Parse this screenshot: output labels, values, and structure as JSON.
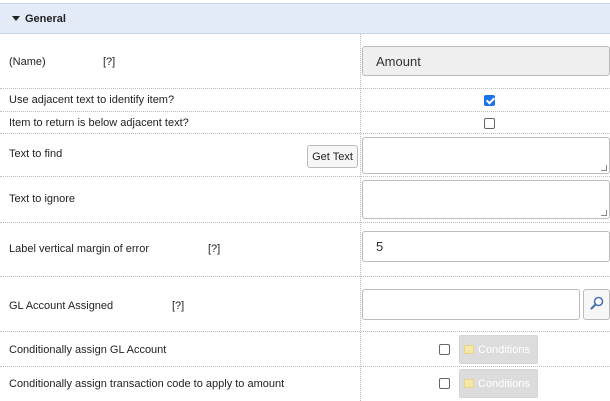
{
  "section": {
    "title": "General"
  },
  "help_marker": "[?]",
  "rows": {
    "name": {
      "label": "(Name)",
      "value": "Amount"
    },
    "use_adjacent": {
      "label": "Use adjacent text to identify item?",
      "checked": true
    },
    "below_adjacent": {
      "label": "Item to return is below adjacent text?",
      "checked": false
    },
    "text_to_find": {
      "label": "Text to find",
      "button": "Get Text",
      "value": ""
    },
    "text_to_ignore": {
      "label": "Text to ignore",
      "value": ""
    },
    "label_margin": {
      "label": "Label vertical margin of error",
      "value": "5"
    },
    "gl_account": {
      "label": "GL Account Assigned",
      "value": ""
    },
    "cond_gl": {
      "label": "Conditionally assign GL Account",
      "checked": false,
      "button": "Conditions"
    },
    "cond_txn": {
      "label": "Conditionally assign transaction code to apply to amount",
      "checked": false,
      "button": "Conditions"
    }
  },
  "colors": {
    "header_bg": "#e2ebf7",
    "checkbox_accent": "#1a73e8",
    "readonly_bg": "#efefef"
  }
}
